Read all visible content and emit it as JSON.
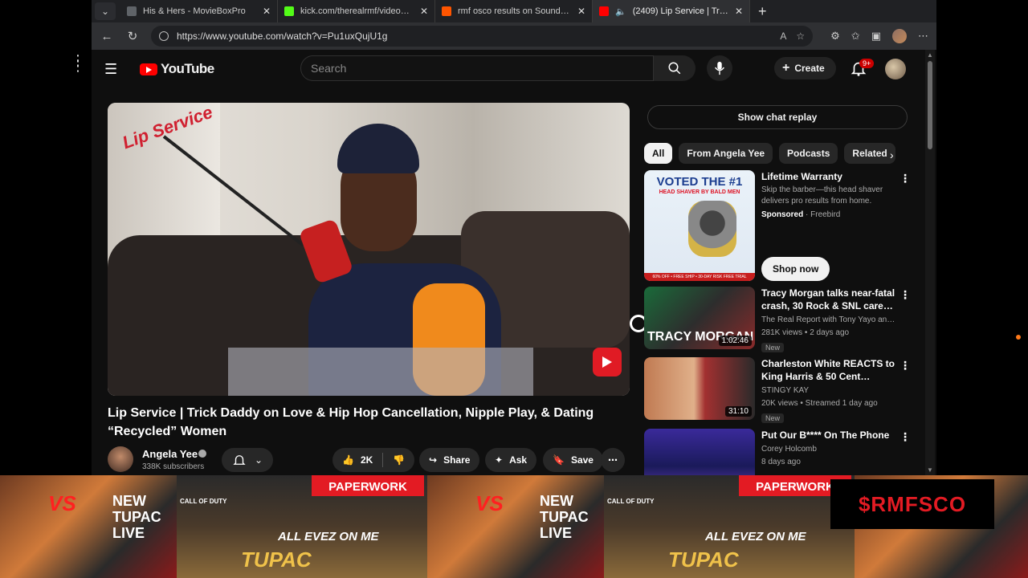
{
  "browser": {
    "tabs": [
      {
        "title": "His & Hers - MovieBoxPro",
        "favicon_color": "#5f6368",
        "active": false
      },
      {
        "title": "kick.com/therealrmf/videos/dfb(",
        "favicon_color": "#53fc18",
        "active": false
      },
      {
        "title": "rmf osco results on SoundCloud",
        "favicon_color": "#ff5500",
        "active": false
      },
      {
        "title": "(2409) Lip Service | Trick Da",
        "favicon_color": "#ff0000",
        "active": true
      }
    ],
    "url": "https://www.youtube.com/watch?v=Pu1uxQujU1g"
  },
  "youtube": {
    "logo_text": "YouTube",
    "search_placeholder": "Search",
    "create_label": "Create",
    "notif_count": "9+"
  },
  "video": {
    "brand_overlay": "Lip Service",
    "title": "Lip Service | Trick Daddy on Love & Hip Hop Cancellation, Nipple Play, & Dating “Recycled” Women",
    "channel": "Angela Yee",
    "subscribers": "338K subscribers",
    "likes": "2K",
    "share_label": "Share",
    "ask_label": "Ask",
    "save_label": "Save"
  },
  "sidebar": {
    "chat_replay_label": "Show chat replay",
    "chips": [
      "All",
      "From Angela Yee",
      "Podcasts",
      "Related"
    ],
    "ad": {
      "thumb_headline": "VOTED THE #1",
      "thumb_sub": "HEAD SHAVER BY BALD MEN",
      "thumb_band": "60% OFF • FREE SHIP • 30-DAY RISK FREE TRIAL",
      "title": "Lifetime Warranty",
      "description": "Skip the barber—this head shaver delivers pro results from home.",
      "sponsored": "Sponsored",
      "advertiser": "Freebird",
      "cta": "Shop now"
    },
    "recommendations": [
      {
        "title": "Tracy Morgan talks near-fatal crash, 30 Rock & SNL career, h...",
        "channel": "The Real Report with Tony Yayo and Uncl...",
        "meta": "281K views • 2 days ago",
        "badge": "New",
        "duration": "1:02:46",
        "thumb_text": "TRACY MORGAN"
      },
      {
        "title": "Charleston White REACTS to King Harris & 50 Cent Situatio...",
        "channel": "STINGY KAY",
        "meta": "20K views • Streamed 1 day ago",
        "badge": "New",
        "duration": "31:10",
        "thumb_text": ""
      },
      {
        "title": "Put Our B**** On The Phone",
        "channel": "Corey Holcomb",
        "meta": "8 days ago",
        "badge": "",
        "duration": "",
        "thumb_text": ""
      }
    ]
  },
  "overlay": {
    "banner_vs": "VS",
    "banner_new": "NEW TUPAC LIVE",
    "banner_paperwork": "PAPERWORK",
    "banner_cod": "CALL OF DUTY",
    "banner_evez": "ALL EVEZ ON ME",
    "banner_tupac": "TUPAC",
    "rmf_badge": "$RMFSCO"
  }
}
